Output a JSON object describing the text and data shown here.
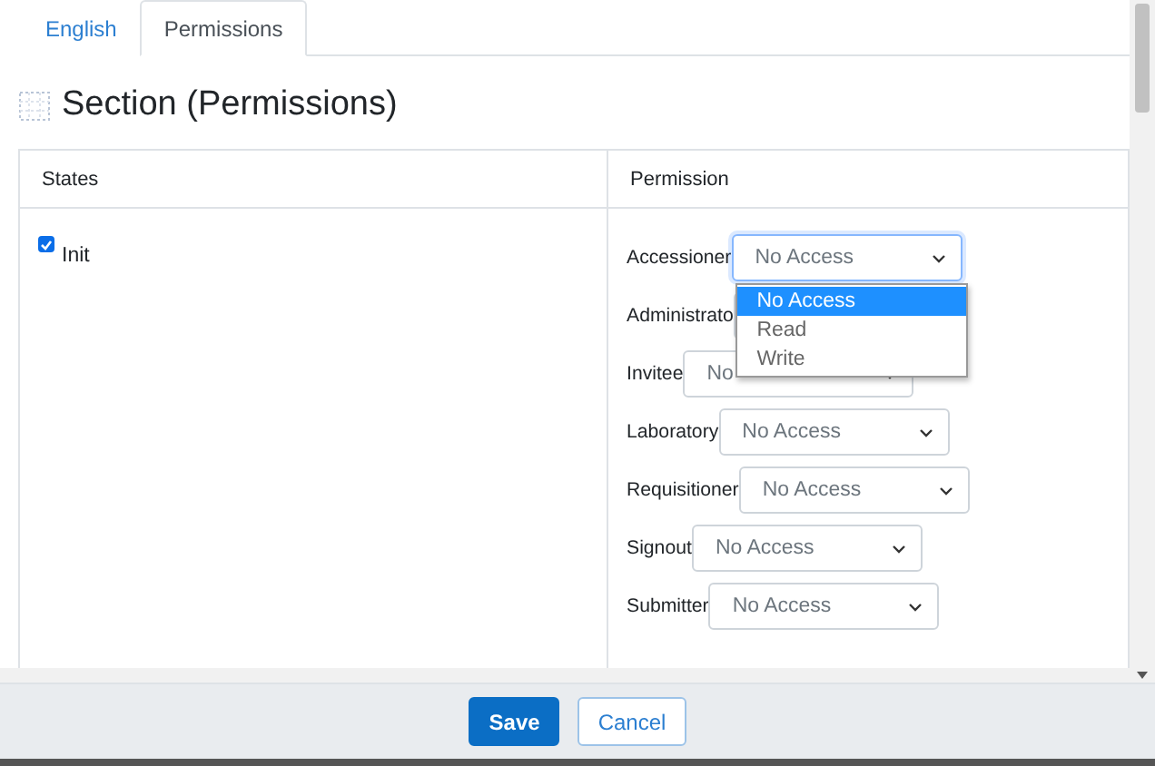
{
  "tabs": [
    {
      "label": "English",
      "selected": false
    },
    {
      "label": "Permissions",
      "selected": true
    }
  ],
  "heading": "Section (Permissions)",
  "table": {
    "columns": [
      "States",
      "Permission"
    ],
    "states": [
      {
        "label": "Init",
        "checked": true
      }
    ],
    "permissions": [
      {
        "label": "Accessioner",
        "value": "No Access",
        "focused": true,
        "menu": [
          {
            "label": "No Access",
            "selected": true
          },
          {
            "label": "Read",
            "selected": false
          },
          {
            "label": "Write",
            "selected": false
          }
        ]
      },
      {
        "label": "Administrato",
        "focused": false
      },
      {
        "label": "Invitee",
        "value": "No",
        "focused": false
      },
      {
        "label": "Laboratory",
        "value": "No Access",
        "focused": false
      },
      {
        "label": "Requisitioner",
        "value": "No Access",
        "focused": false
      },
      {
        "label": "Signout",
        "value": "No Access",
        "focused": false
      },
      {
        "label": "Submitter",
        "value": "No Access",
        "focused": false
      }
    ]
  },
  "buttons": [
    {
      "label": "Save",
      "kind": "primary"
    },
    {
      "label": "Cancel",
      "kind": "secondary"
    }
  ]
}
